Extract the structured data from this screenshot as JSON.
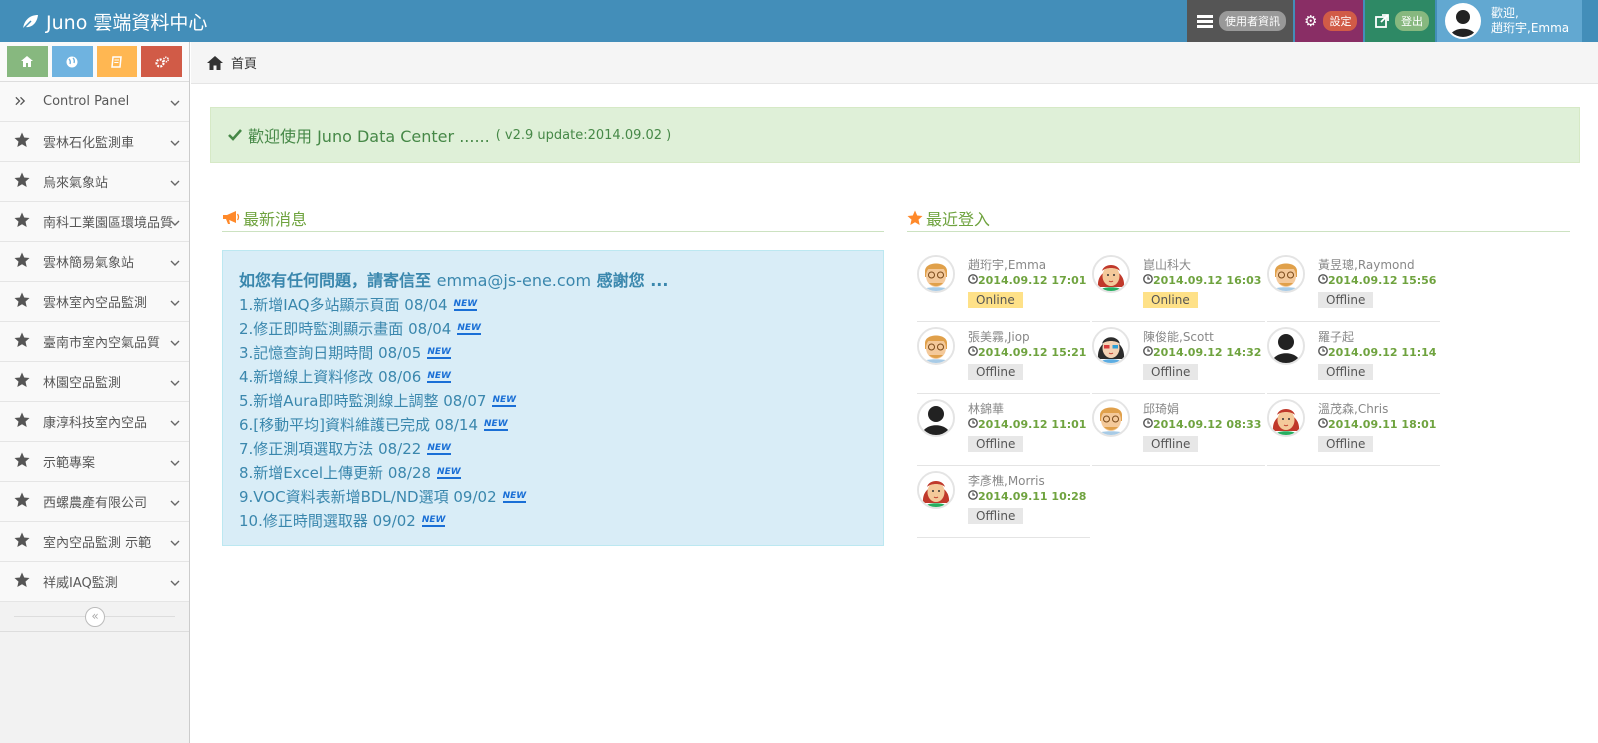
{
  "brand": {
    "title": "Juno 雲端資料中心"
  },
  "navbar": {
    "user_info": "使用者資訊",
    "settings": "設定",
    "logout": "登出",
    "welcome_line1": "歡迎,",
    "welcome_line2": "趙珩宇,Emma"
  },
  "shortcuts": [
    {
      "icon": "home-icon",
      "color": "#87b87f"
    },
    {
      "icon": "globe-icon",
      "color": "#6fb3e0"
    },
    {
      "icon": "book-icon",
      "color": "#ffb752"
    },
    {
      "icon": "cogs-icon",
      "color": "#d15b47"
    }
  ],
  "sidebar": {
    "items": [
      {
        "label": "Control Panel",
        "icon": "double-angle-right-icon"
      },
      {
        "label": "雲林石化監測車",
        "icon": "star-icon"
      },
      {
        "label": "烏來氣象站",
        "icon": "star-icon"
      },
      {
        "label": "南科工業園區環境品質",
        "icon": "star-icon"
      },
      {
        "label": "雲林簡易氣象站",
        "icon": "star-icon"
      },
      {
        "label": "雲林室內空品監測",
        "icon": "star-icon"
      },
      {
        "label": "臺南市室內空氣品質",
        "icon": "star-icon"
      },
      {
        "label": "林園空品監測",
        "icon": "star-icon"
      },
      {
        "label": "康淳科技室內空品",
        "icon": "star-icon"
      },
      {
        "label": "示範專案",
        "icon": "star-icon"
      },
      {
        "label": "西螺農產有限公司",
        "icon": "star-icon"
      },
      {
        "label": "室內空品監測 示範",
        "icon": "star-icon"
      },
      {
        "label": "祥威IAQ監測",
        "icon": "star-icon"
      }
    ],
    "collapse_glyph": "«"
  },
  "breadcrumb": {
    "home": "首頁"
  },
  "alert": {
    "text": "歡迎使用 Juno Data Center ......",
    "version": "( v2.9 update:2014.09.02 )"
  },
  "news": {
    "title": "最新消息",
    "head_prefix": "如您有任何問題，請寄信至",
    "head_email": "emma@js-ene.com",
    "head_suffix": "感謝您 ...",
    "new_tag": "NEW",
    "items": [
      "1.新增IAQ多站顯示頁面 08/04",
      "2.修正即時監測顯示畫面 08/04",
      "3.記憶查詢日期時間 08/05",
      "4.新增線上資料修改 08/06",
      "5.新增Aura即時監測線上調整 08/07",
      "6.[移動平均]資料維護已完成 08/14",
      "7.修正測項選取方法 08/22",
      "8.新增Excel上傳更新 08/28",
      "9.VOC資料表新增BDL/ND選項 09/02",
      "10.修正時間選取器 09/02"
    ]
  },
  "logins": {
    "title": "最近登入",
    "users": [
      {
        "name": "趙珩宇,Emma",
        "time": "2014.09.12 17:01",
        "status": "Online",
        "avatar": "male-glasses"
      },
      {
        "name": "崑山科大",
        "time": "2014.09.12 16:03",
        "status": "Online",
        "avatar": "female-red"
      },
      {
        "name": "黃昱璁,Raymond",
        "time": "2014.09.12 15:56",
        "status": "Offline",
        "avatar": "male-glasses"
      },
      {
        "name": "張美霧,Jiop",
        "time": "2014.09.12 15:21",
        "status": "Offline",
        "avatar": "male-glasses"
      },
      {
        "name": "陳俊能,Scott",
        "time": "2014.09.12 14:32",
        "status": "Offline",
        "avatar": "female-dark"
      },
      {
        "name": "羅子起",
        "time": "2014.09.12 11:14",
        "status": "Offline",
        "avatar": "silhouette"
      },
      {
        "name": "林錦華",
        "time": "2014.09.12 11:01",
        "status": "Offline",
        "avatar": "silhouette"
      },
      {
        "name": "邱琦娟",
        "time": "2014.09.12 08:33",
        "status": "Offline",
        "avatar": "male-glasses"
      },
      {
        "name": "溫茂森,Chris",
        "time": "2014.09.11 18:01",
        "status": "Offline",
        "avatar": "female-red"
      },
      {
        "name": "李彥樵,Morris",
        "time": "2014.09.11 10:28",
        "status": "Offline",
        "avatar": "female-red"
      }
    ]
  }
}
